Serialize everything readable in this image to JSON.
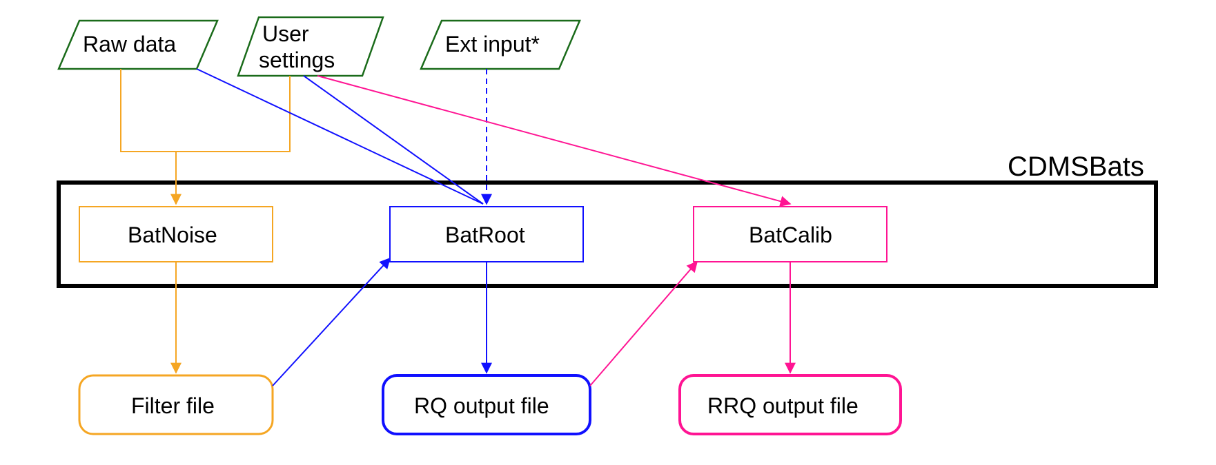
{
  "inputs": {
    "raw_data": "Raw data",
    "user_settings_l1": "User",
    "user_settings_l2": "settings",
    "ext_input": "Ext input*"
  },
  "container_title": "CDMSBats",
  "modules": {
    "batnoise": "BatNoise",
    "batroot": "BatRoot",
    "batcalib": "BatCalib"
  },
  "outputs": {
    "filter_file": "Filter file",
    "rq_output": "RQ output file",
    "rrq_output": "RRQ output file"
  },
  "colors": {
    "green": "#1a6b1a",
    "orange": "#f5a623",
    "blue": "#1010ff",
    "pink": "#ff1493",
    "black": "#000000"
  }
}
